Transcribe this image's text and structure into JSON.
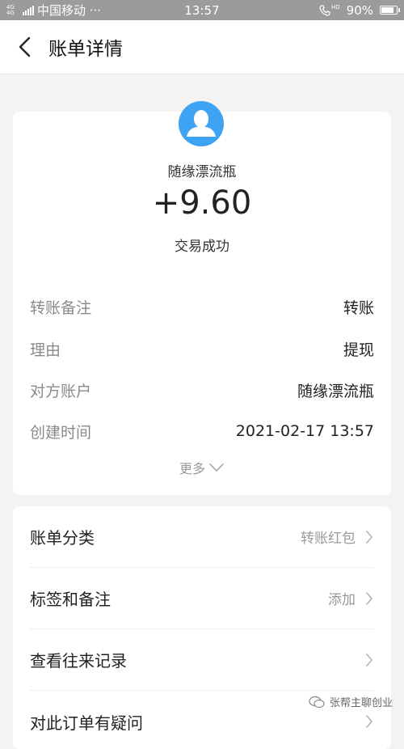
{
  "status_bar": {
    "network": "4G 4G",
    "carrier": "中国移动 ···",
    "time": "13:57",
    "hd": "HD",
    "battery": "90%"
  },
  "header": {
    "title": "账单详情"
  },
  "summary": {
    "payer": "随缘漂流瓶",
    "amount": "+9.60",
    "status": "交易成功"
  },
  "details": [
    {
      "label": "转账备注",
      "value": "转账"
    },
    {
      "label": "理由",
      "value": "提现"
    },
    {
      "label": "对方账户",
      "value": "随缘漂流瓶"
    },
    {
      "label": "创建时间",
      "value": "2021-02-17 13:57"
    }
  ],
  "more_label": "更多",
  "menu": [
    {
      "label": "账单分类",
      "value": "转账红包"
    },
    {
      "label": "标签和备注",
      "value": "添加"
    },
    {
      "label": "查看往来记录",
      "value": ""
    },
    {
      "label": "对此订单有疑问",
      "value": ""
    }
  ],
  "watermark": "张帮主聊创业",
  "colors": {
    "avatar": "#3fa3f3",
    "background": "#f3f3f3",
    "status_bar": "#9b9b9b"
  }
}
